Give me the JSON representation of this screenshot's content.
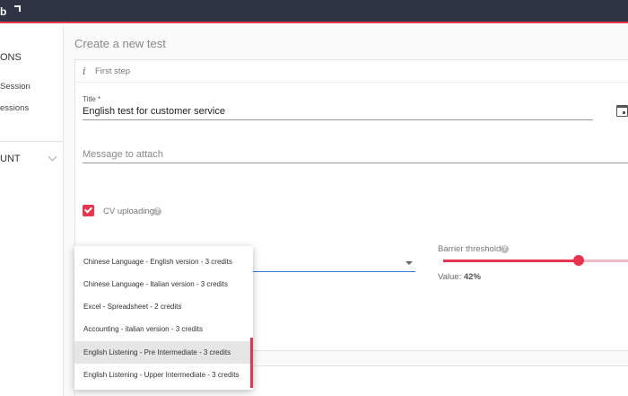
{
  "topbar": {
    "brand": "b"
  },
  "sidebar": {
    "section1": "ONS",
    "item1": "Session",
    "item2": "essions",
    "section2": "UNT"
  },
  "page_title": "Create a new test",
  "step": {
    "label": "First step"
  },
  "form": {
    "title_label": "Title *",
    "title_value": "English test for customer service",
    "message_placeholder": "Message to attach",
    "cv_label": "CV uploading",
    "barrier_label": "Barrier threshold",
    "value_prefix": "Value:",
    "value_text": "42%",
    "threshold_percent": 42
  },
  "dropdown": {
    "items": [
      "Chinese Language - English version - 3 credits",
      "Chinese Language - Italian version - 3 credits",
      "Excel - Spreadsheet - 2 credits",
      "Accounting - italian version - 3 credits",
      "English Listening - Pre Intermediate - 3 credits",
      "English Listening - Upper Intermediate - 3 credits"
    ],
    "highlighted_index": 4
  },
  "colors": {
    "accent": "#e8344e",
    "topbar": "#2f3444",
    "focus": "#3a7bd5"
  }
}
